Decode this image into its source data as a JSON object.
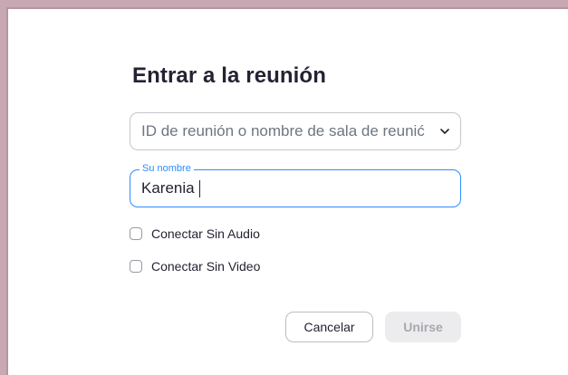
{
  "dialog": {
    "title": "Entrar a la reunión",
    "meeting_id_placeholder": "ID de reunión o nombre de sala de reunić",
    "name_label": "Su nombre",
    "name_value": "Karenia",
    "audio_option": "Conectar Sin Audio",
    "video_option": "Conectar Sin Video",
    "cancel_label": "Cancelar",
    "join_label": "Unirse"
  },
  "colors": {
    "accent": "#2d8cff",
    "title_text": "#232333",
    "join_disabled_bg": "#ececef",
    "join_disabled_text": "#a8a8ad"
  },
  "icons": {
    "dropdown": "chevron-down-icon"
  }
}
